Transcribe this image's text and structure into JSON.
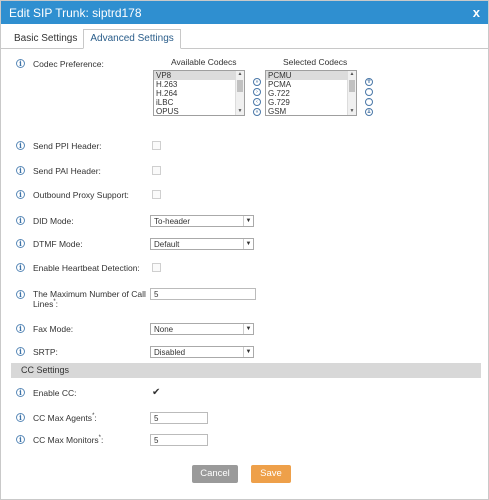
{
  "dialog": {
    "title": "Edit SIP Trunk: siptrd178",
    "close_glyph": "x"
  },
  "tabs": [
    {
      "label": "Basic Settings",
      "active": false
    },
    {
      "label": "Advanced Settings",
      "active": true
    }
  ],
  "codecs": {
    "label": "Codec Preference:",
    "available_header": "Available Codecs",
    "selected_header": "Selected Codecs",
    "available": [
      "VP8",
      "H.263",
      "H.264",
      "iLBC",
      "OPUS"
    ],
    "selected": [
      "PCMU",
      "PCMA",
      "G.722",
      "G.729",
      "GSM"
    ],
    "available_highlight": "VP8",
    "selected_highlight": "PCMU"
  },
  "fields": {
    "send_ppi": {
      "label": "Send PPI Header:"
    },
    "send_pai": {
      "label": "Send PAI Header:"
    },
    "outbound_proxy": {
      "label": "Outbound Proxy Support:"
    },
    "did_mode": {
      "label": "DID Mode:",
      "value": "To-header"
    },
    "dtmf_mode": {
      "label": "DTMF Mode:",
      "value": "Default"
    },
    "heartbeat": {
      "label": "Enable Heartbeat Detection:"
    },
    "max_calls": {
      "label_line1": "The Maximum Number of Call",
      "label_line2": "Lines",
      "required_mark": "*",
      "label_end": ":",
      "value": "5"
    },
    "fax_mode": {
      "label": "Fax Mode:",
      "value": "None"
    },
    "srtp": {
      "label": "SRTP:",
      "value": "Disabled"
    }
  },
  "cc": {
    "section_title": "CC Settings",
    "enable_cc": {
      "label": "Enable CC:",
      "checked": true,
      "check_glyph": "✔"
    },
    "max_agents": {
      "label": "CC Max Agents",
      "required_mark": "*",
      "label_end": ":",
      "value": "5"
    },
    "max_monitors": {
      "label": "CC Max Monitors",
      "required_mark": "*",
      "label_end": ":",
      "value": "5"
    }
  },
  "buttons": {
    "cancel": "Cancel",
    "save": "Save"
  },
  "icons": {
    "info": "i",
    "dropdown_arrow": "▼",
    "scroll_up": "▲",
    "scroll_down": "▼"
  },
  "colors": {
    "titlebar": "#2f8fd0",
    "save": "#eea04a",
    "cancel": "#9a9a9a"
  }
}
